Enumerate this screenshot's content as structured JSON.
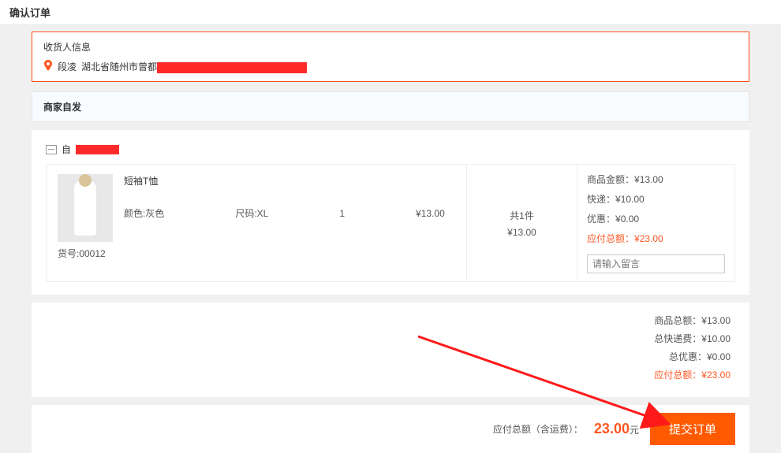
{
  "header": {
    "title": "确认订单"
  },
  "recipient": {
    "section_title": "收货人信息",
    "name": "段凌",
    "address_prefix": "湖北省随州市曾都"
  },
  "shipping": {
    "section_title": "商家自发"
  },
  "merchant": {
    "name_prefix": "自"
  },
  "product": {
    "title": "短袖T恤",
    "color_label": "颜色:灰色",
    "size_label": "尺码:XL",
    "qty": "1",
    "price": "¥13.00",
    "sku_label": "货号:00012"
  },
  "subtotal_box": {
    "count_label": "共1件",
    "subtotal": "¥13.00"
  },
  "right_summary": {
    "goods_label": "商品金额：",
    "goods_value": "¥13.00",
    "express_label": "快递：",
    "express_value": "¥10.00",
    "discount_label": "优惠：",
    "discount_value": "¥0.00",
    "total_label": "应付总额：",
    "total_value": "¥23.00",
    "message_placeholder": "请输入留言"
  },
  "summary": {
    "goods_label": "商品总额：",
    "goods_value": "¥13.00",
    "express_label": "总快递费：",
    "express_value": "¥10.00",
    "discount_label": "总优惠：",
    "discount_value": "¥0.00",
    "total_label": "应付总额：",
    "total_value": "¥23.00"
  },
  "submit": {
    "label": "应付总额（含运费）：",
    "amount": "23.00",
    "unit": "元",
    "button": "提交订单"
  }
}
